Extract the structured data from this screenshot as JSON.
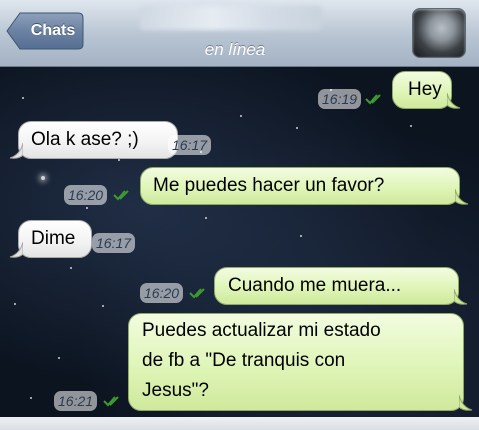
{
  "header": {
    "back_label": "Chats",
    "status": "en línea"
  },
  "messages": [
    {
      "direction": "out",
      "text": "Hey",
      "time": "16:19",
      "read": true
    },
    {
      "direction": "in",
      "text": "Ola k ase? ;)",
      "time": "16:17"
    },
    {
      "direction": "out",
      "text": "Me puedes hacer un favor?",
      "time": "16:20",
      "read": true
    },
    {
      "direction": "in",
      "text": "Dime",
      "time": "16:17"
    },
    {
      "direction": "out",
      "text": "Cuando me muera...",
      "time": "16:20",
      "read": true
    },
    {
      "direction": "out",
      "lines": [
        "Puedes actualizar mi estado",
        "de fb a \"De tranquis con",
        "Jesus\"?"
      ],
      "time": "16:21",
      "read": true
    }
  ],
  "colors": {
    "outgoing_bubble": "#dff5b8",
    "incoming_bubble": "#f2f2f2",
    "read_ticks": "#3c9a2e",
    "header": "#b8c4d2"
  },
  "icons": [
    "back-arrow-button",
    "double-check-icon"
  ]
}
